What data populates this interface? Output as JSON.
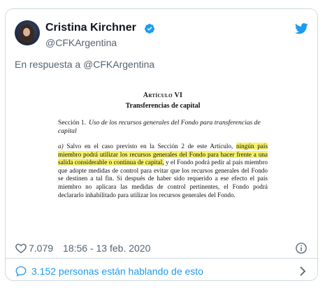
{
  "tweet": {
    "author": {
      "display_name": "Cristina Kirchner",
      "handle": "@CFKArgentina",
      "verified": true
    },
    "reply_prefix": "En respuesta a",
    "reply_mention": "@CFKArgentina",
    "document": {
      "heading": "Artículo VI",
      "subheading": "Transferencias de capital",
      "section_label": "Sección 1.",
      "section_title": "Uso de los recursos generales del Fondo para transferencias de capital",
      "para_lead": "a)",
      "para_text_before": "Salvo en el caso previsto en la Sección 2 de este Artículo,",
      "para_highlight": "ningún país miembro podrá utilizar los recursos generales del Fondo para hacer frente a una salida considerable o continua de capital,",
      "para_text_after": "y el Fondo podrá pedir al país miembro que adopte medidas de control para evitar que los recursos generales del Fondo se destinen a tal fin. Si después de haber sido requerido a ese efecto el país miembro no aplicara las medidas de control pertinentes, el Fondo podrá declararlo inhabilitado para utilizar los recursos generales del Fondo.",
      "highlight_color": "#f7f26a"
    },
    "likes": "7.079",
    "timestamp": "18:56 - 13 feb. 2020",
    "conversation_text": "3.152 personas están hablando de esto"
  },
  "icons": {
    "brand": "twitter-icon",
    "verified": "verified-badge-icon",
    "like": "heart-icon",
    "info": "info-icon",
    "conversation": "speech-bubble-icon",
    "chevron": "chevron-right-icon"
  },
  "colors": {
    "accent": "#1d9bf0",
    "secondary_text": "#536471",
    "border": "#cfd9de"
  }
}
